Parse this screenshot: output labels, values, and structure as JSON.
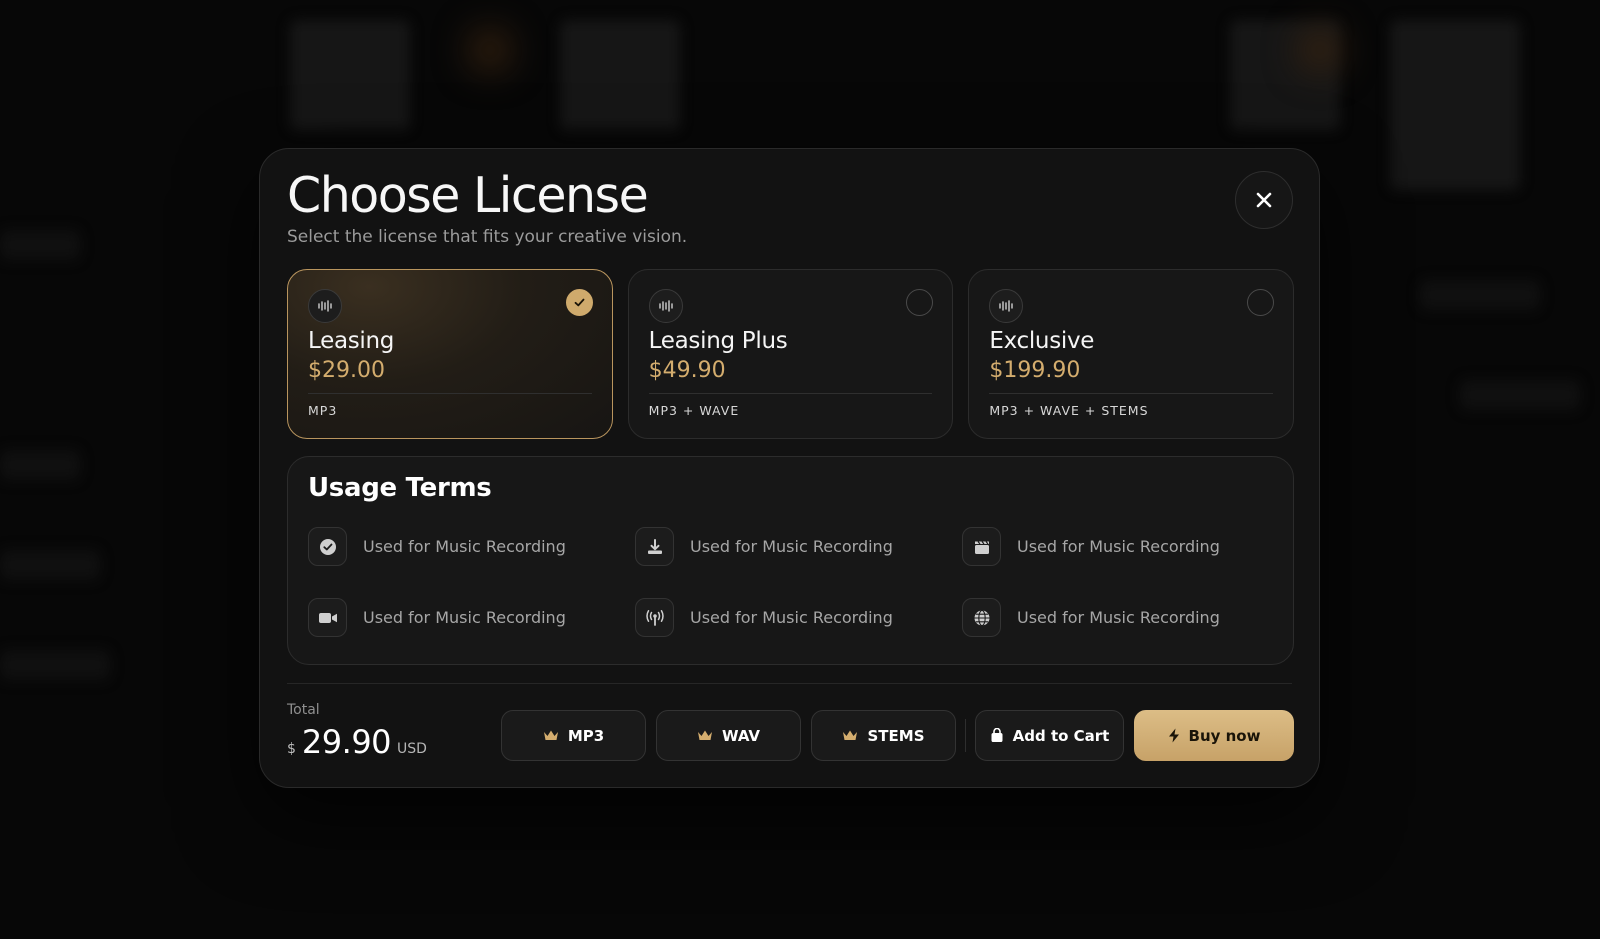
{
  "modal": {
    "title": "Choose License",
    "subtitle": "Select the license that fits your creative vision."
  },
  "licenses": [
    {
      "name": "Leasing",
      "price": "$29.00",
      "formats": "MP3",
      "selected": true
    },
    {
      "name": "Leasing Plus",
      "price": "$49.90",
      "formats": "MP3 + WAVE",
      "selected": false
    },
    {
      "name": "Exclusive",
      "price": "$199.90",
      "formats": "MP3 + WAVE + STEMS",
      "selected": false
    }
  ],
  "usage_terms": {
    "title": "Usage Terms",
    "items": [
      {
        "icon": "check-circle-icon",
        "label": "Used for Music Recording"
      },
      {
        "icon": "download-icon",
        "label": "Used for Music Recording"
      },
      {
        "icon": "clapperboard-icon",
        "label": "Used for Music Recording"
      },
      {
        "icon": "video-camera-icon",
        "label": "Used for Music Recording"
      },
      {
        "icon": "broadcast-icon",
        "label": "Used for Music Recording"
      },
      {
        "icon": "globe-icon",
        "label": "Used for Music Recording"
      }
    ]
  },
  "total": {
    "label": "Total",
    "currency_symbol": "$",
    "amount": "29.90",
    "unit": "USD"
  },
  "actions": {
    "mp3": "MP3",
    "wav": "WAV",
    "stems": "STEMS",
    "add_to_cart": "Add to Cart",
    "buy_now": "Buy now"
  },
  "colors": {
    "accent": "#d4ad6e",
    "background": "#070707",
    "panel": "#121212"
  }
}
